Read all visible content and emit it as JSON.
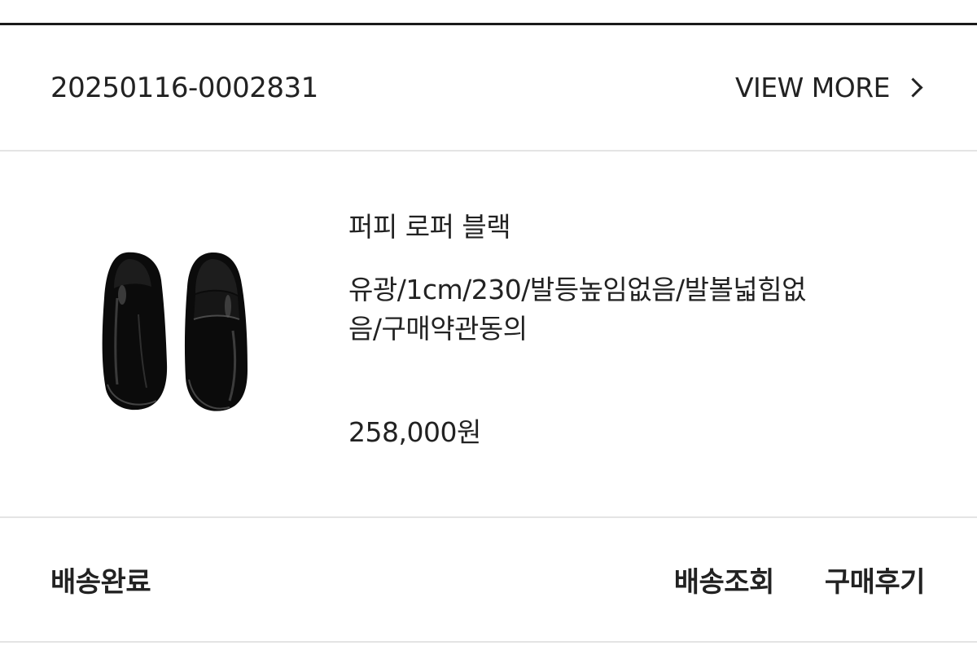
{
  "order": {
    "number": "20250116-0002831",
    "view_more_label": "VIEW MORE",
    "view_more_icon": "chevron-right-icon"
  },
  "product": {
    "name": "퍼피 로퍼 블랙",
    "options": "유광/1cm/230/발등높임없음/발볼넓힘없음/구매약관동의",
    "price": "258,000원",
    "image_icon": "loafer-shoes-image"
  },
  "footer": {
    "status": "배송완료",
    "track_label": "배송조회",
    "review_label": "구매후기"
  },
  "colors": {
    "text": "#222222",
    "divider": "#e4e4e4",
    "top_rule": "#1a1a1a"
  }
}
